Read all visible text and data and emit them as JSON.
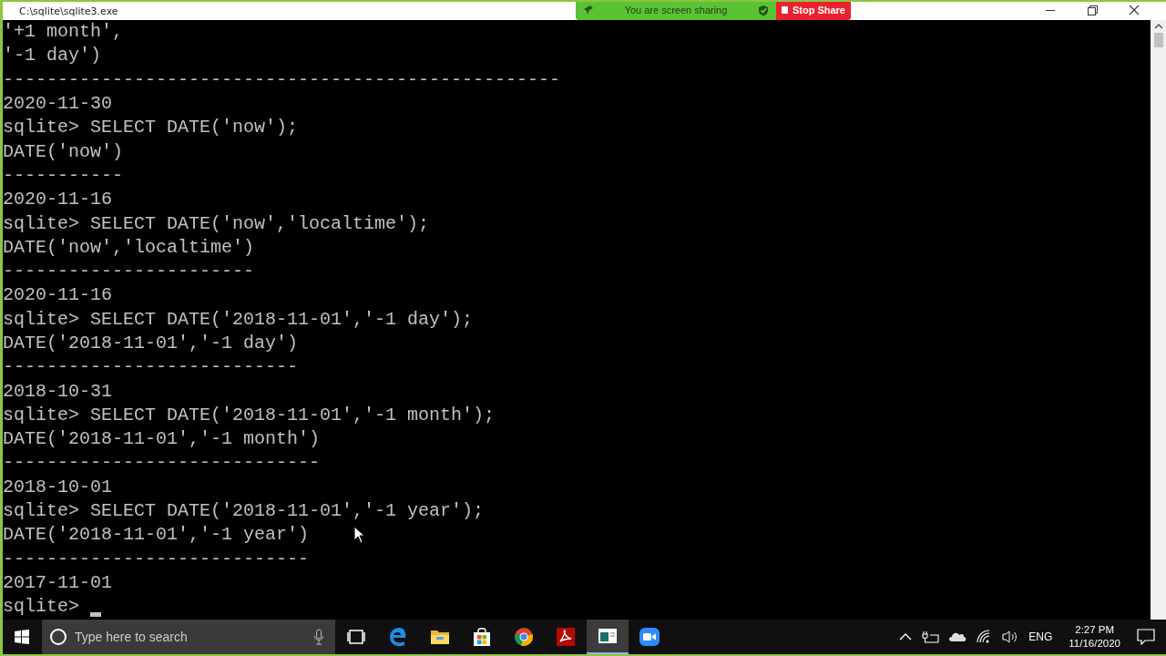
{
  "window": {
    "title": "C:\\sqlite\\sqlite3.exe"
  },
  "share_bar": {
    "status": "You are screen sharing",
    "stop_button": "Stop Share"
  },
  "console": {
    "lines": [
      "'+1 month',",
      "'-1 day')",
      "---------------------------------------------------",
      "2020-11-30",
      "sqlite> SELECT DATE('now');",
      "DATE('now')",
      "-----------",
      "2020-11-16",
      "sqlite> SELECT DATE('now','localtime');",
      "DATE('now','localtime')",
      "-----------------------",
      "2020-11-16",
      "sqlite> SELECT DATE('2018-11-01','-1 day');",
      "DATE('2018-11-01','-1 day')",
      "---------------------------",
      "2018-10-31",
      "sqlite> SELECT DATE('2018-11-01','-1 month');",
      "DATE('2018-11-01','-1 month')",
      "-----------------------------",
      "2018-10-01",
      "sqlite> SELECT DATE('2018-11-01','-1 year');",
      "DATE('2018-11-01','-1 year')",
      "----------------------------",
      "2017-11-01",
      "sqlite>"
    ]
  },
  "taskbar": {
    "search": {
      "placeholder": "Type here to search"
    },
    "apps": [
      {
        "kind": "taskview",
        "active": false
      },
      {
        "kind": "edge",
        "active": false
      },
      {
        "kind": "explorer",
        "active": false
      },
      {
        "kind": "store",
        "active": false
      },
      {
        "kind": "chrome",
        "active": false
      },
      {
        "kind": "acrobat",
        "active": false
      },
      {
        "kind": "console",
        "active": true
      },
      {
        "kind": "zoom",
        "active": false
      }
    ],
    "tray": {
      "language": "ENG",
      "time": "2:27 PM",
      "date": "11/16/2020"
    }
  }
}
